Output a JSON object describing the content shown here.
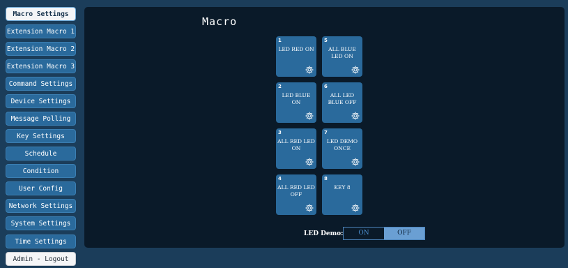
{
  "sidebar": {
    "items": [
      {
        "label": "Macro Settings"
      },
      {
        "label": "Extension Macro 1"
      },
      {
        "label": "Extension Macro 2"
      },
      {
        "label": "Extension Macro 3"
      },
      {
        "label": "Command Settings"
      },
      {
        "label": "Device Settings"
      },
      {
        "label": "Message Polling"
      },
      {
        "label": "Key Settings"
      },
      {
        "label": "Schedule"
      },
      {
        "label": "Condition"
      },
      {
        "label": "User Config"
      },
      {
        "label": "Network Settings"
      },
      {
        "label": "System Settings"
      },
      {
        "label": "Time Settings"
      },
      {
        "label": "Admin - Logout"
      }
    ],
    "active": "Macro Settings"
  },
  "main": {
    "title": "Macro",
    "macros": [
      {
        "num": "1",
        "label": "LED RED ON"
      },
      {
        "num": "2",
        "label": "LED BLUE ON"
      },
      {
        "num": "3",
        "label": "ALL RED LED ON"
      },
      {
        "num": "4",
        "label": "ALL RED LED OFF"
      },
      {
        "num": "5",
        "label": "ALL BLUE LED ON"
      },
      {
        "num": "6",
        "label": "ALL LED BLUE OFF"
      },
      {
        "num": "7",
        "label": "LED DEMO ONCE"
      },
      {
        "num": "8",
        "label": "KEY 8"
      }
    ],
    "gear_icon": "gear-icon",
    "led_demo": {
      "label": "LED Demo:",
      "on_label": "ON",
      "off_label": "OFF",
      "selected": "OFF"
    }
  },
  "colors": {
    "background": "#1b3d5a",
    "panel": "#0a1a29",
    "tile": "#2a6a9c",
    "toggle_selected": "#6a9fd3"
  }
}
